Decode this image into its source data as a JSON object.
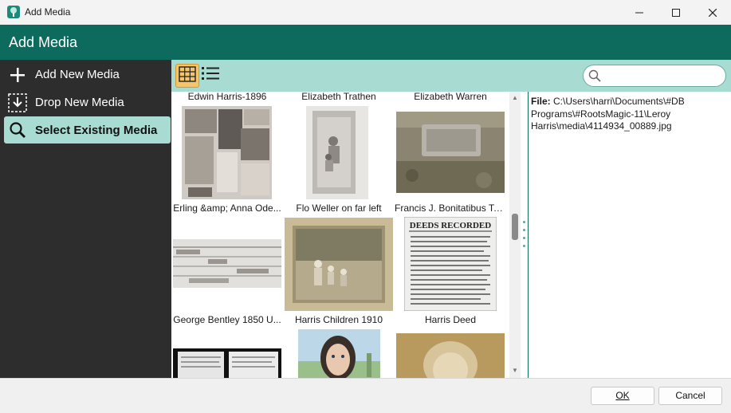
{
  "window": {
    "title": "Add Media"
  },
  "header": {
    "title": "Add Media"
  },
  "sidebar": {
    "items": [
      {
        "label": "Add New Media",
        "icon": "plus-icon"
      },
      {
        "label": "Drop New Media",
        "icon": "drop-box-icon"
      },
      {
        "label": "Select Existing Media",
        "icon": "search-icon",
        "active": true
      }
    ]
  },
  "toolbar": {
    "views": [
      "grid-view-icon",
      "list-view-icon"
    ],
    "search": {
      "value": "",
      "placeholder": ""
    }
  },
  "gallery": {
    "top_captions": [
      "Edwin Harris-1896",
      "Elizabeth Trathen",
      "Elizabeth Warren"
    ],
    "rows": [
      {
        "captions": [
          "Erling &amp; Anna Ode...",
          "Flo Weller on far left",
          "Francis J. Bonitatibus To..."
        ]
      },
      {
        "captions": [
          "George Bentley 1850 U...",
          "Harris Children 1910",
          "Harris Deed"
        ]
      }
    ],
    "deed_heading": "DEEDS RECORDED"
  },
  "details": {
    "file_label": "File:",
    "file_path": "C:\\Users\\harri\\Documents\\#DB Programs\\#RootsMagic-11\\Leroy Harris\\media\\4114934_00889.jpg"
  },
  "footer": {
    "ok_label": "OK",
    "cancel_label": "Cancel"
  },
  "colors": {
    "header": "#0d6b5e",
    "accent": "#a8dcd3",
    "sidebar": "#2d2d2d",
    "selected_view": "#f4c56a"
  }
}
